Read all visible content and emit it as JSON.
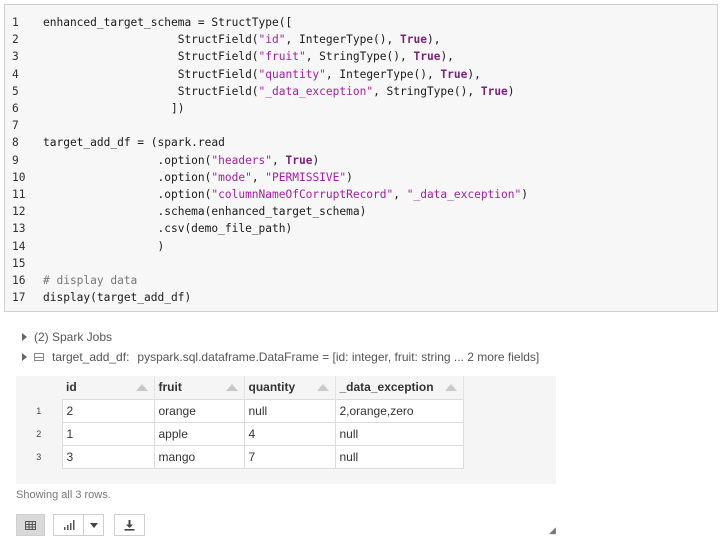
{
  "code": {
    "lines": [
      {
        "n": "1",
        "segments": [
          {
            "t": "enhanced_target_schema = StructType([",
            "c": ""
          }
        ]
      },
      {
        "n": "2",
        "segments": [
          {
            "t": "                    StructField(",
            "c": ""
          },
          {
            "t": "\"id\"",
            "c": "str"
          },
          {
            "t": ", IntegerType(), ",
            "c": ""
          },
          {
            "t": "True",
            "c": "kw"
          },
          {
            "t": "),",
            "c": ""
          }
        ]
      },
      {
        "n": "3",
        "segments": [
          {
            "t": "                    StructField(",
            "c": ""
          },
          {
            "t": "\"fruit\"",
            "c": "str"
          },
          {
            "t": ", StringType(), ",
            "c": ""
          },
          {
            "t": "True",
            "c": "kw"
          },
          {
            "t": "),",
            "c": ""
          }
        ]
      },
      {
        "n": "4",
        "segments": [
          {
            "t": "                    StructField(",
            "c": ""
          },
          {
            "t": "\"quantity\"",
            "c": "str"
          },
          {
            "t": ", IntegerType(), ",
            "c": ""
          },
          {
            "t": "True",
            "c": "kw"
          },
          {
            "t": "),",
            "c": ""
          }
        ]
      },
      {
        "n": "5",
        "segments": [
          {
            "t": "                    StructField(",
            "c": ""
          },
          {
            "t": "\"_data_exception\"",
            "c": "str"
          },
          {
            "t": ", StringType(), ",
            "c": ""
          },
          {
            "t": "True",
            "c": "kw"
          },
          {
            "t": ")",
            "c": ""
          }
        ]
      },
      {
        "n": "6",
        "segments": [
          {
            "t": "                   ])",
            "c": ""
          }
        ]
      },
      {
        "n": "7",
        "segments": []
      },
      {
        "n": "8",
        "segments": [
          {
            "t": "target_add_df = (spark.read",
            "c": ""
          }
        ]
      },
      {
        "n": "9",
        "segments": [
          {
            "t": "                 .option(",
            "c": ""
          },
          {
            "t": "\"headers\"",
            "c": "str"
          },
          {
            "t": ", ",
            "c": ""
          },
          {
            "t": "True",
            "c": "kw"
          },
          {
            "t": ")",
            "c": ""
          }
        ]
      },
      {
        "n": "10",
        "segments": [
          {
            "t": "                 .option(",
            "c": ""
          },
          {
            "t": "\"mode\"",
            "c": "str"
          },
          {
            "t": ", ",
            "c": ""
          },
          {
            "t": "\"PERMISSIVE\"",
            "c": "str"
          },
          {
            "t": ")",
            "c": ""
          }
        ]
      },
      {
        "n": "11",
        "segments": [
          {
            "t": "                 .option(",
            "c": ""
          },
          {
            "t": "\"columnNameOfCorruptRecord\"",
            "c": "str"
          },
          {
            "t": ", ",
            "c": ""
          },
          {
            "t": "\"_data_exception\"",
            "c": "str"
          },
          {
            "t": ")",
            "c": ""
          }
        ]
      },
      {
        "n": "12",
        "segments": [
          {
            "t": "                 .schema(enhanced_target_schema)",
            "c": ""
          }
        ]
      },
      {
        "n": "13",
        "segments": [
          {
            "t": "                 .csv(demo_file_path)",
            "c": ""
          }
        ]
      },
      {
        "n": "14",
        "segments": [
          {
            "t": "                 )",
            "c": ""
          }
        ]
      },
      {
        "n": "15",
        "segments": []
      },
      {
        "n": "16",
        "segments": [
          {
            "t": "# display data",
            "c": "cm"
          }
        ]
      },
      {
        "n": "17",
        "segments": [
          {
            "t": "display(target_add_df)",
            "c": ""
          }
        ]
      }
    ]
  },
  "output": {
    "spark_jobs": "(2) Spark Jobs",
    "df_name": "target_add_df:",
    "df_type": "pyspark.sql.dataframe.DataFrame = [id: integer, fruit: string ... 2 more fields]"
  },
  "table": {
    "columns": [
      "id",
      "fruit",
      "quantity",
      "_data_exception"
    ],
    "rows": [
      {
        "idx": "1",
        "cells": [
          "2",
          "orange",
          "null",
          "2,orange,zero"
        ]
      },
      {
        "idx": "2",
        "cells": [
          "1",
          "apple",
          "4",
          "null"
        ]
      },
      {
        "idx": "3",
        "cells": [
          "3",
          "mango",
          "7",
          "null"
        ]
      }
    ]
  },
  "rows_note": "Showing all 3 rows.",
  "toolbar": {
    "icons": [
      "table-icon",
      "bar-chart-icon",
      "chevron-down-icon",
      "download-icon"
    ]
  }
}
